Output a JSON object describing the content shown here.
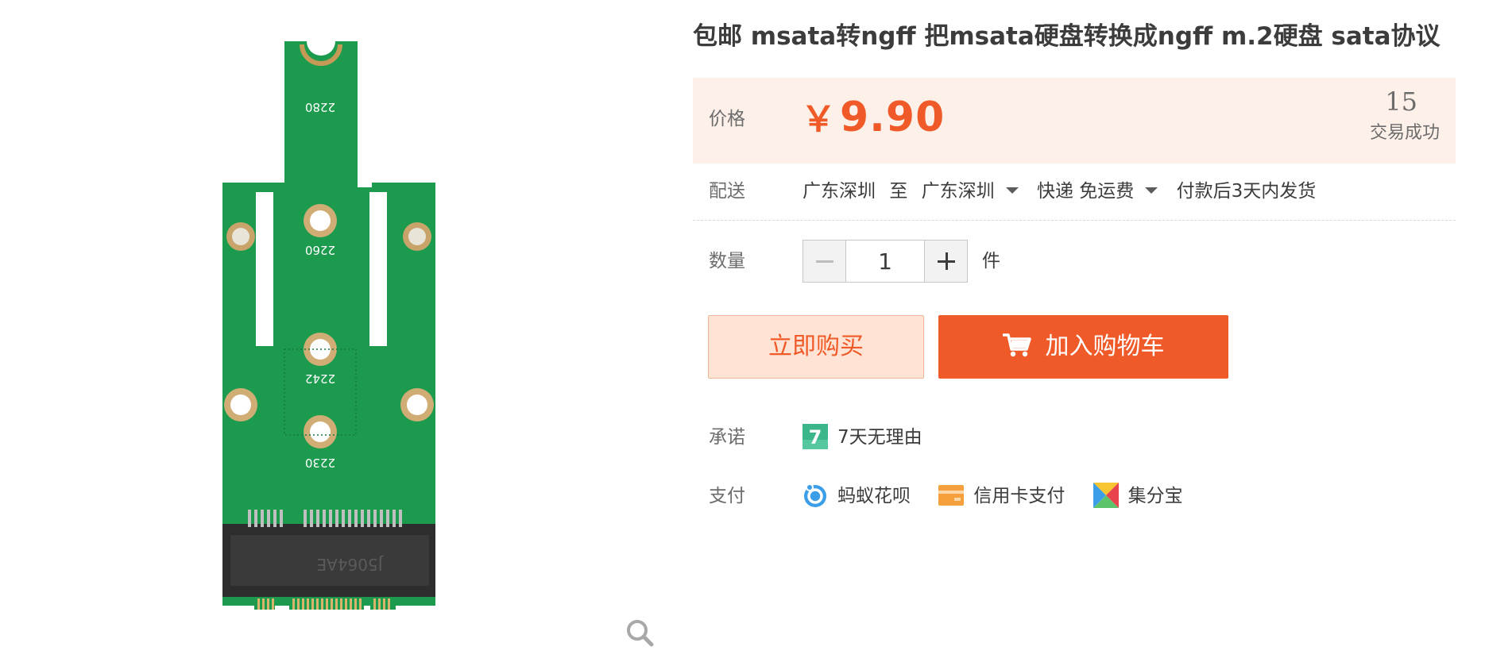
{
  "product": {
    "title": "包邮 msata转ngff 把msata硬盘转换成ngff m.2硬盘 sata协议",
    "board_marks": [
      "2280",
      "2260",
      "2242",
      "2230",
      "J5064AE"
    ]
  },
  "price": {
    "label": "价格",
    "currency": "￥",
    "amount": "9.90",
    "sales_count": "15",
    "sales_label": "交易成功",
    "accent_color": "#f05a28"
  },
  "shipping": {
    "label": "配送",
    "from": "广东深圳",
    "to_word": "至",
    "to": "广东深圳",
    "method": "快递 免运费",
    "dispatch": "付款后3天内发货"
  },
  "quantity": {
    "label": "数量",
    "value": "1",
    "unit": "件",
    "minus_icon": "minus-icon",
    "plus_icon": "plus-icon"
  },
  "actions": {
    "buy_now": "立即购买",
    "add_to_cart": "加入购物车",
    "cart_icon": "shopping-cart-icon"
  },
  "promise": {
    "label": "承诺",
    "icon_text": "7",
    "text": "7天无理由"
  },
  "payment": {
    "label": "支付",
    "methods": [
      {
        "name": "蚂蚁花呗",
        "icon": "huabei-icon"
      },
      {
        "name": "信用卡支付",
        "icon": "credit-card-icon"
      },
      {
        "name": "集分宝",
        "icon": "jifenbao-icon"
      }
    ]
  },
  "gallery": {
    "zoom_icon": "magnifier-icon"
  }
}
